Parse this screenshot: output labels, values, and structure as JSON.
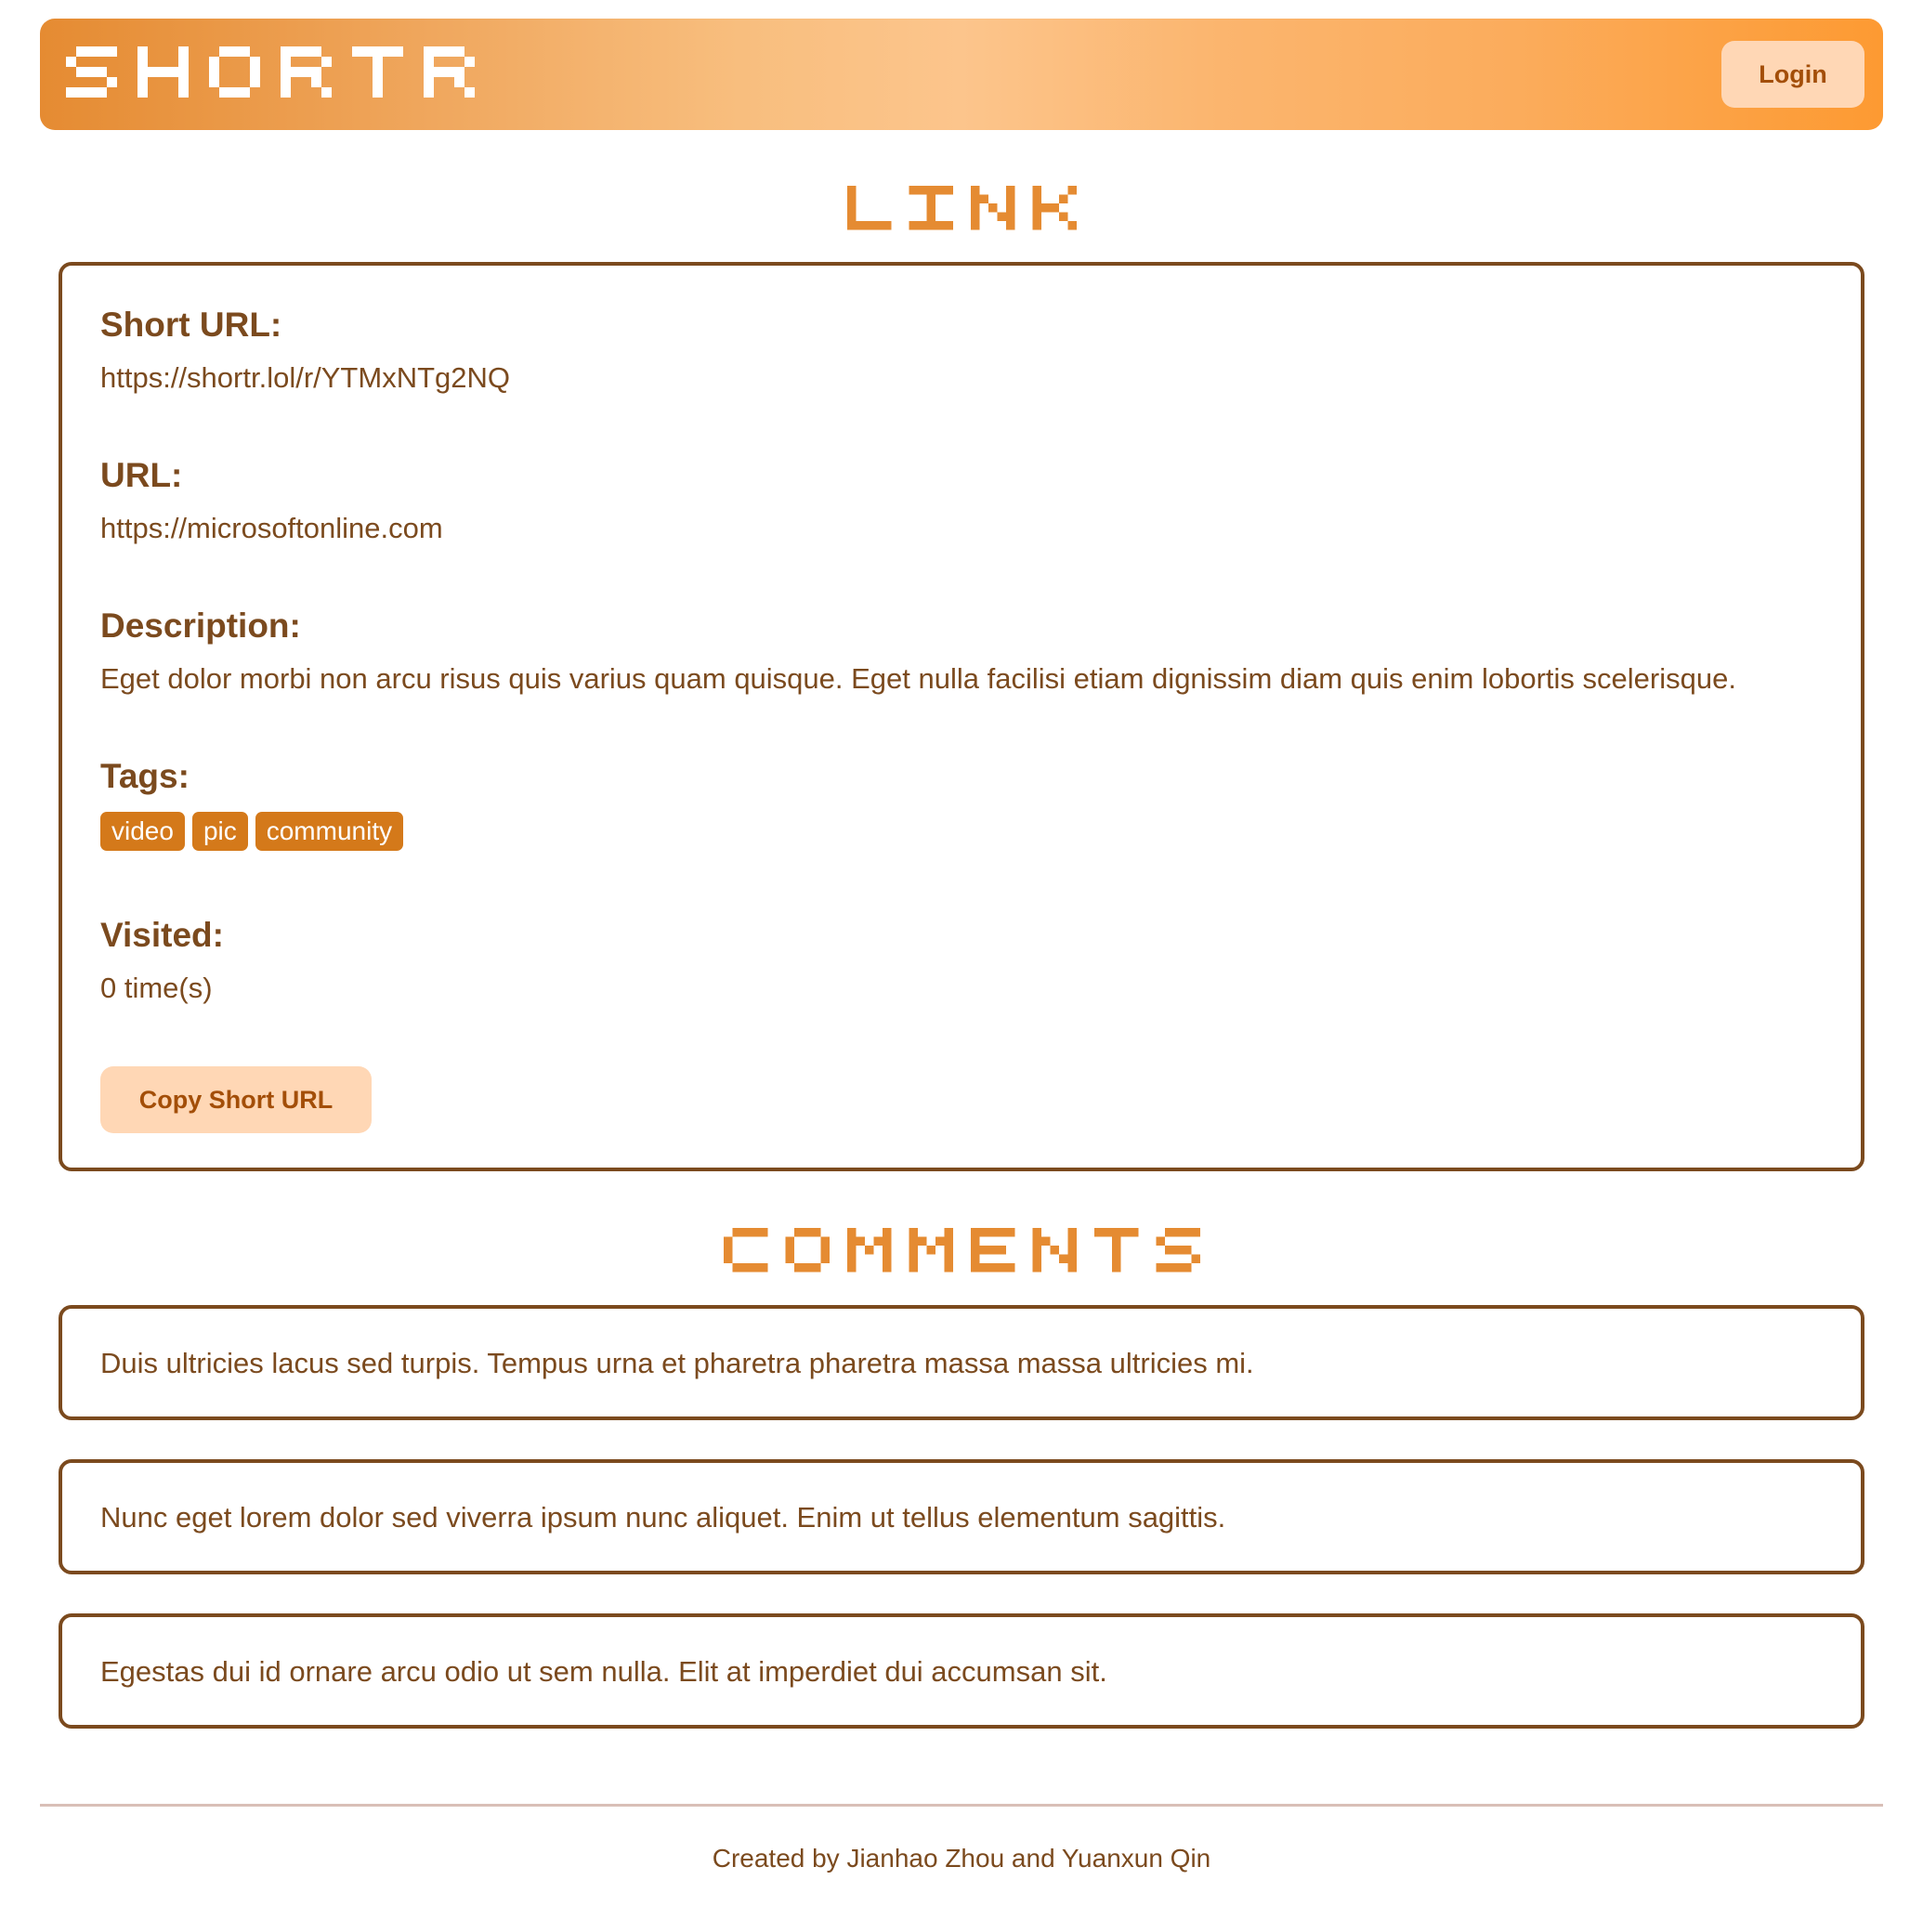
{
  "brand": {
    "name": "SHORTR",
    "color": "#ffffff"
  },
  "header": {
    "login_label": "Login",
    "gradient_start": "#e58b32",
    "gradient_end": "#fd9a32"
  },
  "link_section": {
    "title": "LINK",
    "short_url_label": "Short URL:",
    "short_url": "https://shortr.lol/r/YTMxNTg2NQ",
    "url_label": "URL:",
    "url": "https://microsoftonline.com",
    "description_label": "Description:",
    "description": "Eget dolor morbi non arcu risus quis varius quam quisque. Eget nulla facilisi etiam dignissim diam quis enim lobortis scelerisque.",
    "tags_label": "Tags:",
    "tags": [
      "video",
      "pic",
      "community"
    ],
    "visited_label": "Visited:",
    "visited": "0 time(s)",
    "copy_button_label": "Copy Short URL"
  },
  "comments_section": {
    "title": "COMMENTS",
    "comments": [
      "Duis ultricies lacus sed turpis. Tempus urna et pharetra pharetra massa massa ultricies mi.",
      "Nunc eget lorem dolor sed viverra ipsum nunc aliquet. Enim ut tellus elementum sagittis.",
      "Egestas dui id ornare arcu odio ut sem nulla. Elit at imperdiet dui accumsan sit."
    ]
  },
  "footer": {
    "credit": "Created by Jianhao Zhou and Yuanxun Qin"
  },
  "colors": {
    "text_brown": "#7b4a1e",
    "accent_orange": "#e58b32",
    "tag_orange": "#d4791a",
    "button_peach": "#ffd7b5",
    "button_text": "#a34e08"
  },
  "icons": {
    "brand_logo": "pixel-wordmark"
  }
}
